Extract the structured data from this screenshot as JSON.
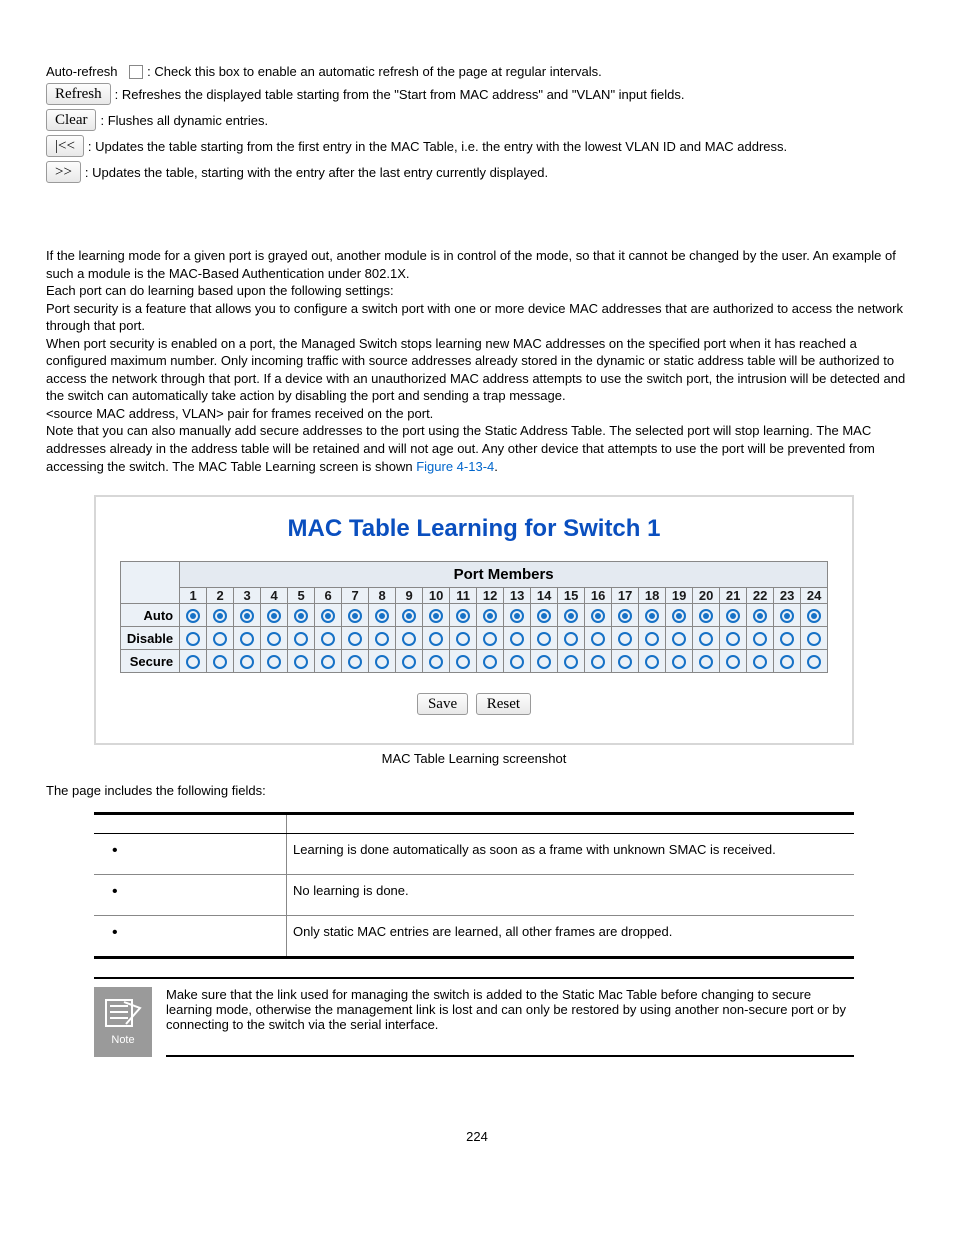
{
  "controls": {
    "autorefresh_label": "Auto-refresh",
    "autorefresh_desc": ": Check this box to enable an automatic refresh of the page at regular intervals.",
    "refresh_btn": "Refresh",
    "refresh_desc": ": Refreshes the displayed table starting from the \"Start from MAC address\" and \"VLAN\" input fields.",
    "clear_btn": "Clear",
    "clear_desc": ": Flushes all dynamic entries.",
    "first_btn": "|<<",
    "first_desc": ": Updates the table starting from the first entry in the MAC Table, i.e. the entry with the lowest VLAN ID and MAC address.",
    "next_btn": ">>",
    "next_desc": ": Updates the table, starting with the entry after the last entry currently displayed."
  },
  "body": {
    "p1": "If the learning mode for a given port is grayed out, another module is in control of the mode, so that it cannot be changed by the user. An example of such a module is the MAC-Based Authentication under 802.1X.",
    "p2": "Each port can do learning based upon the following settings:",
    "p3": "Port security is a feature that allows you to configure a switch port with one or more device MAC addresses that are authorized to access the network through that port.",
    "p4": "When port security is enabled on a port, the Managed Switch stops learning new MAC addresses on the specified port when it has reached a configured maximum number. Only incoming traffic with source addresses already stored in the dynamic or static address table will be authorized to access the network through that port. If a device with an unauthorized MAC address attempts to use the switch port, the intrusion will be detected and the switch can automatically take action by disabling the port and sending a trap message.",
    "p5": "<source MAC address, VLAN> pair for frames received on the port.",
    "p6a": "Note that you can also manually add secure addresses to the port using the Static Address Table. The selected port will stop learning. The MAC addresses already in the address table will be retained and will not age out. Any other device that attempts to use the port will be prevented from accessing the switch. The MAC Table Learning screen is shown ",
    "p6_link": "Figure 4-13-4",
    "p6b": "."
  },
  "chart_data": {
    "type": "table",
    "title": "MAC Table Learning for Switch 1",
    "group_header": "Port Members",
    "port_count": 24,
    "rows": [
      "Auto",
      "Disable",
      "Secure"
    ],
    "selected_row": "Auto",
    "buttons": {
      "save": "Save",
      "reset": "Reset"
    },
    "caption": "MAC Table Learning screenshot"
  },
  "fields_intro": "The page includes the following fields:",
  "fields": [
    {
      "desc": "Learning is done automatically as soon as a frame with unknown SMAC is received."
    },
    {
      "desc": "No learning is done."
    },
    {
      "desc": "Only static MAC entries are learned, all other frames are dropped."
    }
  ],
  "note": {
    "label": "Note",
    "text": "Make sure that the link used for managing the switch is added to the Static Mac Table before changing to secure learning mode, otherwise the management link is lost and can only be restored by using another non-secure port or by connecting to the switch via the serial interface."
  },
  "page_number": "224"
}
